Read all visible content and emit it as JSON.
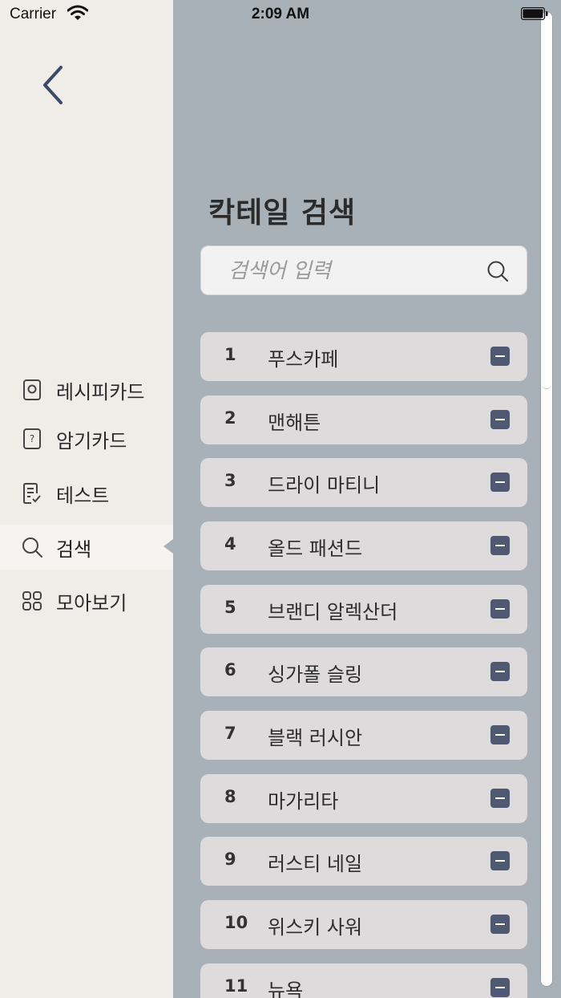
{
  "status_bar": {
    "carrier": "Carrier",
    "time": "2:09 AM"
  },
  "sidebar": {
    "back_icon": "chevron-left-icon",
    "items": [
      {
        "label": "레시피카드",
        "icon": "card-icon"
      },
      {
        "label": "암기카드",
        "icon": "question-card-icon"
      },
      {
        "label": "테스트",
        "icon": "checklist-icon"
      },
      {
        "label": "검색",
        "icon": "search-icon",
        "active": true
      },
      {
        "label": "모아보기",
        "icon": "grid-icon"
      }
    ]
  },
  "main": {
    "title": "칵테일 검색",
    "search": {
      "placeholder": "검색어 입력",
      "value": ""
    },
    "list": [
      {
        "num": "1",
        "name": "푸스카페"
      },
      {
        "num": "2",
        "name": "맨해튼"
      },
      {
        "num": "3",
        "name": "드라이 마티니"
      },
      {
        "num": "4",
        "name": "올드 패션드"
      },
      {
        "num": "5",
        "name": "브랜디 알렉산더"
      },
      {
        "num": "6",
        "name": "싱가폴 슬링"
      },
      {
        "num": "7",
        "name": "블랙 러시안"
      },
      {
        "num": "8",
        "name": "마가리타"
      },
      {
        "num": "9",
        "name": "러스티 네일"
      },
      {
        "num": "10",
        "name": "위스키 사워"
      },
      {
        "num": "11",
        "name": "뉴욕"
      }
    ]
  },
  "colors": {
    "sidebar_bg": "#f0ede8",
    "main_bg": "#a8b1b8",
    "row_bg": "#dddbdb",
    "remove_button": "#4f5a72",
    "back_arrow": "#3b4a66"
  }
}
